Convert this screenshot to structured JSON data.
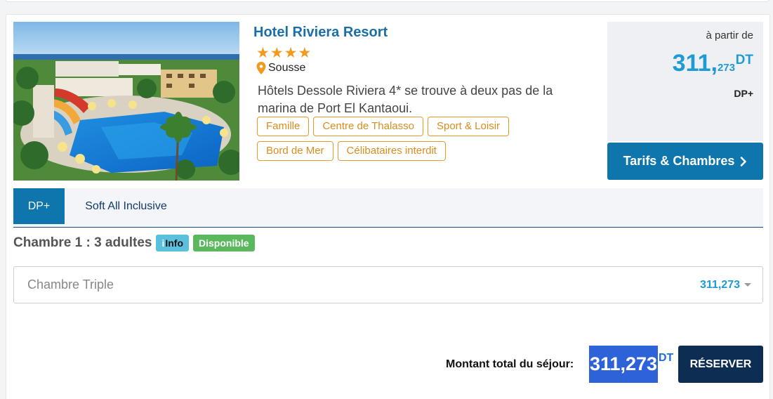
{
  "hotel": {
    "name": "Hotel Riviera Resort",
    "stars": "★★★★",
    "location": "Sousse",
    "description": "Hôtels Dessole Riviera 4* se trouve à deux pas de la marina de Port El Kantaoui.",
    "tags": [
      "Famille",
      "Centre de Thalasso",
      "Sport & Loisir",
      "Bord de Mer",
      "Célibataires interdit"
    ]
  },
  "price_box": {
    "from_label": "à partir de",
    "price_int": "311,",
    "price_dec": "273",
    "currency": "DT",
    "board": "DP+"
  },
  "buttons": {
    "tarifs_label": "Tarifs & Chambres",
    "reserve_label": "RÉSERVER"
  },
  "tabs": [
    {
      "label": "DP+",
      "active": true
    },
    {
      "label": "Soft All Inclusive",
      "active": false
    }
  ],
  "room": {
    "label": "Chambre 1 : 3 adultes",
    "info_i": "i",
    "info_text": "Info",
    "status": "Disponible",
    "selected_type": "Chambre Triple",
    "selected_price": "311,273"
  },
  "total": {
    "label": "Montant total du séjour:",
    "amount": "311,273",
    "currency": "DT"
  },
  "colors": {
    "brand_blue": "#0e76ad",
    "price_blue": "#1e9bd2",
    "tag_orange": "#e39a2a",
    "reserve_navy": "#0d2d52",
    "total_blue": "#2e62d8",
    "available_green": "#5cb85c",
    "info_cyan": "#5bc0de"
  }
}
